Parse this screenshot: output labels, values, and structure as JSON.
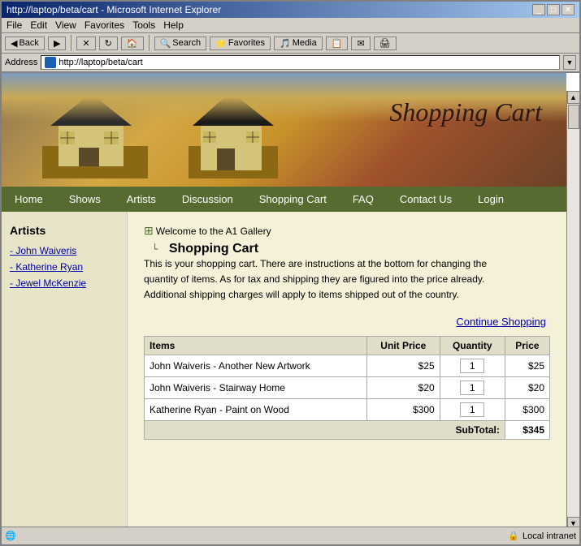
{
  "browser": {
    "title": "http://laptop/beta/cart - Microsoft Internet Explorer",
    "url": "http://laptop/beta/cart",
    "address_label": "Address"
  },
  "menu": {
    "items": [
      "File",
      "Edit",
      "View",
      "Favorites",
      "Tools",
      "Help"
    ]
  },
  "toolbar": {
    "back": "Back",
    "forward": "Forward",
    "stop": "Stop",
    "refresh": "Refresh",
    "home": "Home",
    "search": "Search",
    "favorites": "Favorites",
    "media": "Media",
    "history": "History"
  },
  "nav": {
    "items": [
      "Home",
      "Shows",
      "Artists",
      "Discussion",
      "Shopping Cart",
      "FAQ",
      "Contact Us",
      "Login"
    ]
  },
  "site": {
    "header_title": "Shopping Cart"
  },
  "sidebar": {
    "title": "Artists",
    "links": [
      {
        "label": "- John Waiveris"
      },
      {
        "label": "- Katherine Ryan"
      },
      {
        "label": "- Jewel McKenzie"
      }
    ]
  },
  "content": {
    "breadcrumb_home": "Welcome to the A1 Gallery",
    "page_title": "Shopping Cart",
    "description": "This is your shopping cart. There are instructions at the bottom for changing the quantity of items. As for tax and shipping they are figured into the price already. Additional shipping charges will apply to items shipped out of the country.",
    "continue_shopping": "Continue Shopping",
    "table": {
      "headers": [
        "Items",
        "Unit Price",
        "Quantity",
        "Price"
      ],
      "rows": [
        {
          "item": "John Waiveris - Another New Artwork",
          "unit_price": "$25",
          "qty": "1",
          "price": "$25"
        },
        {
          "item": "John Waiveris - Stairway Home",
          "unit_price": "$20",
          "qty": "1",
          "price": "$20"
        },
        {
          "item": "Katherine Ryan - Paint on Wood",
          "unit_price": "$300",
          "qty": "1",
          "price": "$300"
        }
      ],
      "subtotal_label": "SubTotal:",
      "subtotal_value": "$345"
    }
  },
  "status": {
    "left": "",
    "right": "Local intranet"
  }
}
